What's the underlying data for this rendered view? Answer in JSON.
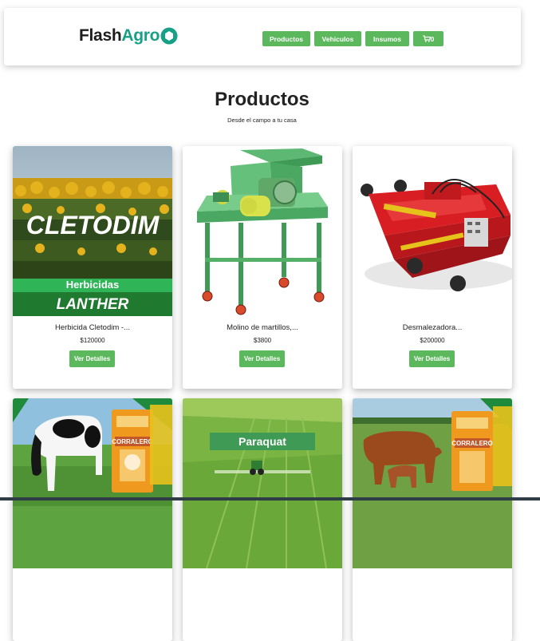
{
  "brand": {
    "part1": "Flash",
    "part2": "Agro"
  },
  "nav": {
    "productos": "Productos",
    "vehiculos": "Vehiculos",
    "insumos": "Insumos",
    "cart_count": "0"
  },
  "header": {
    "title": "Productos",
    "subtitle": "Desde el campo a tu casa"
  },
  "products": [
    {
      "title": "Herbicida Cletodim -...",
      "price": "$120000",
      "button": "Ver Detalles",
      "image_text": {
        "main": "CLETODIM",
        "band": "Herbicidas",
        "brand": "LANTHER"
      }
    },
    {
      "title": "Molino de martillos,...",
      "price": "$3800",
      "button": "Ver Detalles"
    },
    {
      "title": "Desmalezadora...",
      "price": "$200000",
      "button": "Ver Detalles"
    },
    {
      "image_text": {
        "bag": "CORRALERO"
      }
    },
    {
      "image_text": {
        "main": "Paraquat"
      }
    },
    {
      "image_text": {
        "bag": "CORRALERO"
      }
    }
  ],
  "colors": {
    "accent_green": "#5cb85c",
    "brand_teal": "#16a085"
  }
}
